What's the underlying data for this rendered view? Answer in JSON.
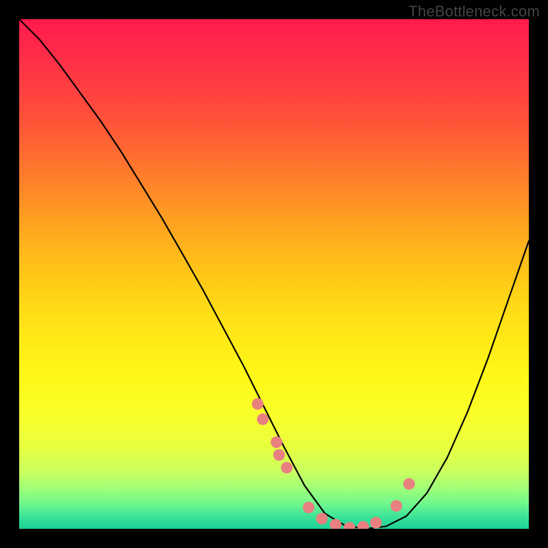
{
  "watermark": "TheBottleneck.com",
  "colors": {
    "background": "#000000",
    "curve_stroke": "#000000",
    "dot_fill": "#e98080"
  },
  "chart_data": {
    "type": "line",
    "title": "",
    "xlabel": "",
    "ylabel": "",
    "xlim": [
      0,
      1
    ],
    "ylim": [
      0,
      1
    ],
    "note": "No axes or tick labels present; values below are relative (0–1) positions within the plot area. y is measured upward from the bottom edge.",
    "series": [
      {
        "name": "curve",
        "x": [
          0.0,
          0.04,
          0.08,
          0.12,
          0.16,
          0.2,
          0.24,
          0.28,
          0.32,
          0.36,
          0.4,
          0.44,
          0.48,
          0.52,
          0.56,
          0.6,
          0.64,
          0.68,
          0.72,
          0.76,
          0.8,
          0.84,
          0.88,
          0.92,
          0.96,
          1.0
        ],
        "y": [
          1.0,
          0.96,
          0.91,
          0.855,
          0.8,
          0.74,
          0.675,
          0.61,
          0.54,
          0.47,
          0.395,
          0.32,
          0.24,
          0.16,
          0.085,
          0.03,
          0.006,
          0.0,
          0.005,
          0.025,
          0.07,
          0.14,
          0.23,
          0.335,
          0.45,
          0.565
        ]
      }
    ],
    "scatter_points": {
      "name": "dots",
      "x": [
        0.468,
        0.478,
        0.505,
        0.51,
        0.525,
        0.568,
        0.594,
        0.621,
        0.648,
        0.675,
        0.7,
        0.74,
        0.765
      ],
      "y": [
        0.245,
        0.215,
        0.17,
        0.145,
        0.12,
        0.042,
        0.02,
        0.008,
        0.002,
        0.004,
        0.012,
        0.045,
        0.088
      ]
    }
  }
}
